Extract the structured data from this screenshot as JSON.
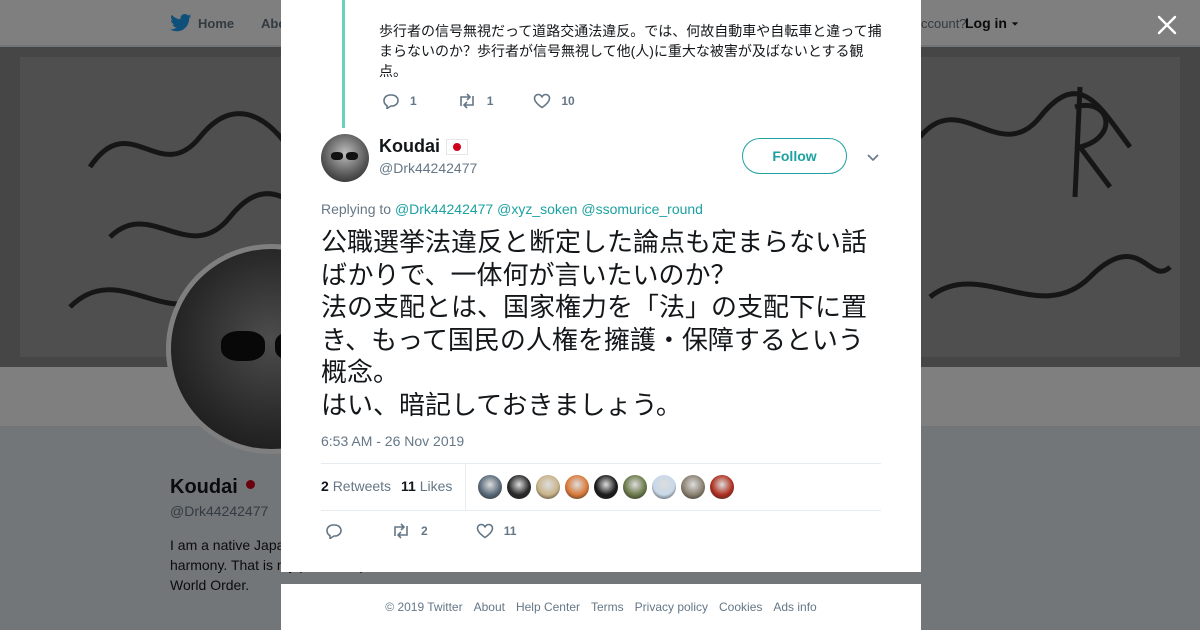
{
  "nav": {
    "home_label": "Home",
    "about_label": "Abo",
    "account_text": "ccount?",
    "login_label": "Log in"
  },
  "profile_bg": {
    "name": "Koudai",
    "handle": "@Drk44242477",
    "bio": "I am a native Japa society that value harmony. That is my pride. Stop!Now World Order."
  },
  "previous_tweet": {
    "text": "歩行者の信号無視だって道路交通法違反。では、何故自動車や自転車と違って捕まらないのか？歩行者が信号無視して他(人)に重大な被害が及ばないとする観点。",
    "replies": "1",
    "retweets": "1",
    "likes": "10"
  },
  "tweet": {
    "author_name": "Koudai",
    "author_handle": "@Drk44242477",
    "follow_label": "Follow",
    "replying_prefix": "Replying to",
    "replying_to": [
      "@Drk44242477",
      "@xyz_soken",
      "@ssomurice_round"
    ],
    "text": "公職選挙法違反と断定した論点も定まらない話ばかりで、一体何が言いたいのか？\n法の支配とは、国家権力を「法」の支配下に置き、もって国民の人権を擁護・保障するという概念。\nはい、暗記しておきましょう。",
    "timestamp": "6:53 AM - 26 Nov 2019",
    "retweet_count": "2",
    "retweets_label": "Retweets",
    "like_count": "11",
    "likes_label": "Likes",
    "action_retweets": "2",
    "action_likes": "11"
  },
  "colors": {
    "accent": "#1da1a1",
    "thread_line": "#6ad0c0",
    "flag_red": "#d0021b"
  },
  "likers": [
    "#5a6a7a",
    "#2a2a2a",
    "#c9b48a",
    "#d97a3a",
    "#1a1a1a",
    "#6b7a4a",
    "#c8d8e8",
    "#8a8070",
    "#b03020"
  ],
  "footer": {
    "links": [
      "© 2019 Twitter",
      "About",
      "Help Center",
      "Terms",
      "Privacy policy",
      "Cookies",
      "Ads info"
    ]
  }
}
